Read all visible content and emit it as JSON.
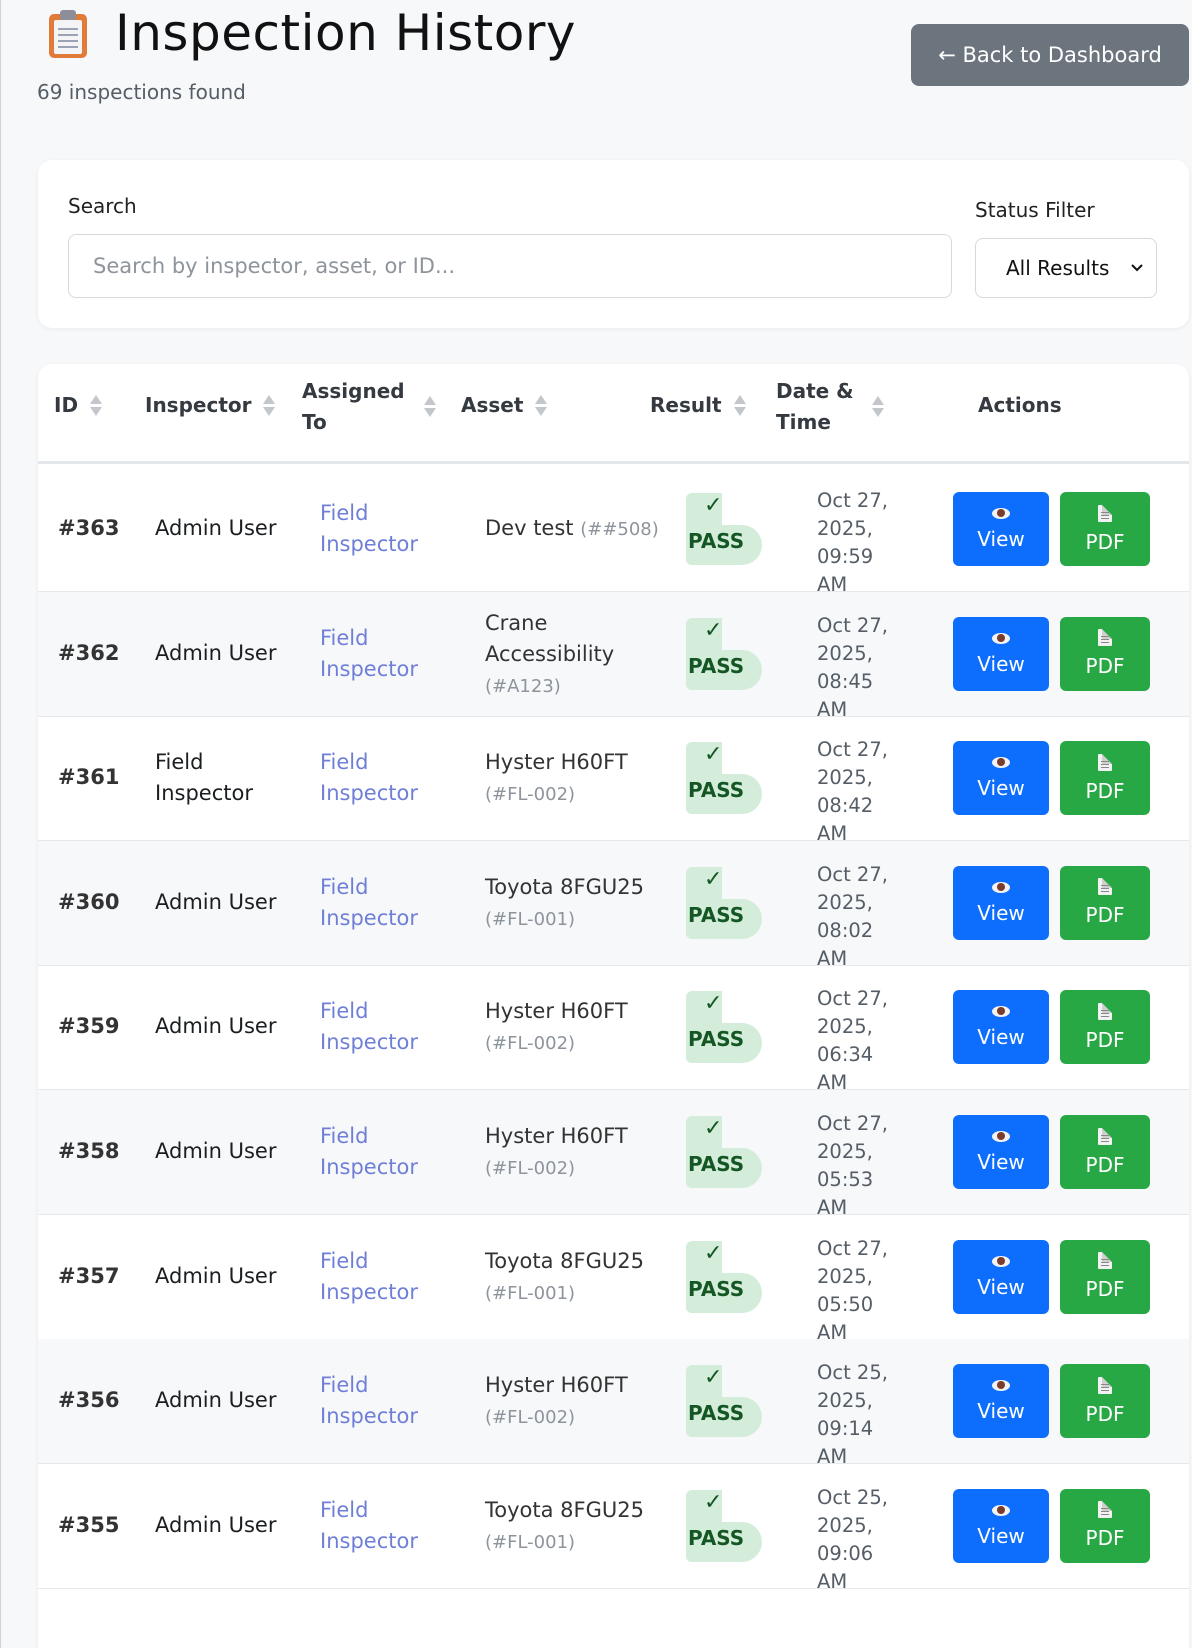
{
  "header": {
    "title": "Inspection History",
    "subtitle": "69 inspections found",
    "back_label": "← Back to Dashboard"
  },
  "filters": {
    "search_label": "Search",
    "search_placeholder": "Search by inspector, asset, or ID...",
    "search_value": "",
    "status_label": "Status Filter",
    "status_selected": "All Results"
  },
  "table": {
    "columns": {
      "id": "ID",
      "inspector": "Inspector",
      "assigned_line1": "Assigned",
      "assigned_line2": "To",
      "asset": "Asset",
      "result": "Result",
      "date_line1": "Date &",
      "date_line2": "Time",
      "actions": "Actions"
    },
    "rows": [
      {
        "id": "#363",
        "inspector": "Admin User",
        "assigned": "Field Inspector",
        "asset": "Dev test",
        "asset_code": "(##508)",
        "result_check": "✓",
        "result": "PASS",
        "date": "Oct 27, 2025, 09:59 AM",
        "view": "View",
        "pdf": "PDF"
      },
      {
        "id": "#362",
        "inspector": "Admin User",
        "assigned": "Field Inspector",
        "asset": "Crane Accessibility",
        "asset_code": "(#A123)",
        "result_check": "✓",
        "result": "PASS",
        "date": "Oct 27, 2025, 08:45 AM",
        "view": "View",
        "pdf": "PDF"
      },
      {
        "id": "#361",
        "inspector": "Field Inspector",
        "assigned": "Field Inspector",
        "asset": "Hyster H60FT",
        "asset_code": "(#FL-002)",
        "result_check": "✓",
        "result": "PASS",
        "date": "Oct 27, 2025, 08:42 AM",
        "view": "View",
        "pdf": "PDF"
      },
      {
        "id": "#360",
        "inspector": "Admin User",
        "assigned": "Field Inspector",
        "asset": "Toyota 8FGU25",
        "asset_code": "(#FL-001)",
        "result_check": "✓",
        "result": "PASS",
        "date": "Oct 27, 2025, 08:02 AM",
        "view": "View",
        "pdf": "PDF"
      },
      {
        "id": "#359",
        "inspector": "Admin User",
        "assigned": "Field Inspector",
        "asset": "Hyster H60FT",
        "asset_code": "(#FL-002)",
        "result_check": "✓",
        "result": "PASS",
        "date": "Oct 27, 2025, 06:34 AM",
        "view": "View",
        "pdf": "PDF"
      },
      {
        "id": "#358",
        "inspector": "Admin User",
        "assigned": "Field Inspector",
        "asset": "Hyster H60FT",
        "asset_code": "(#FL-002)",
        "result_check": "✓",
        "result": "PASS",
        "date": "Oct 27, 2025, 05:53 AM",
        "view": "View",
        "pdf": "PDF"
      },
      {
        "id": "#357",
        "inspector": "Admin User",
        "assigned": "Field Inspector",
        "asset": "Toyota 8FGU25",
        "asset_code": "(#FL-001)",
        "result_check": "✓",
        "result": "PASS",
        "date": "Oct 27, 2025, 05:50 AM",
        "view": "View",
        "pdf": "PDF"
      },
      {
        "id": "#356",
        "inspector": "Admin User",
        "assigned": "Field Inspector",
        "asset": "Hyster H60FT",
        "asset_code": "(#FL-002)",
        "result_check": "✓",
        "result": "PASS",
        "date": "Oct 25, 2025, 09:14 AM",
        "view": "View",
        "pdf": "PDF"
      },
      {
        "id": "#355",
        "inspector": "Admin User",
        "assigned": "Field Inspector",
        "asset": "Toyota 8FGU25",
        "asset_code": "(#FL-001)",
        "result_check": "✓",
        "result": "PASS",
        "date": "Oct 25, 2025, 09:06 AM",
        "view": "View",
        "pdf": "PDF"
      }
    ]
  },
  "colors": {
    "view_button": "#0d6efd",
    "pdf_button": "#28a745",
    "pass_badge_bg": "#d4edda",
    "pass_badge_text": "#155724",
    "assigned_link": "#6f7fd8",
    "back_button": "#6c757d"
  },
  "icons": {
    "title": "clipboard-icon",
    "view": "eye-icon",
    "pdf": "document-icon",
    "sort": "sort-icon",
    "select": "chevron-down-icon"
  }
}
